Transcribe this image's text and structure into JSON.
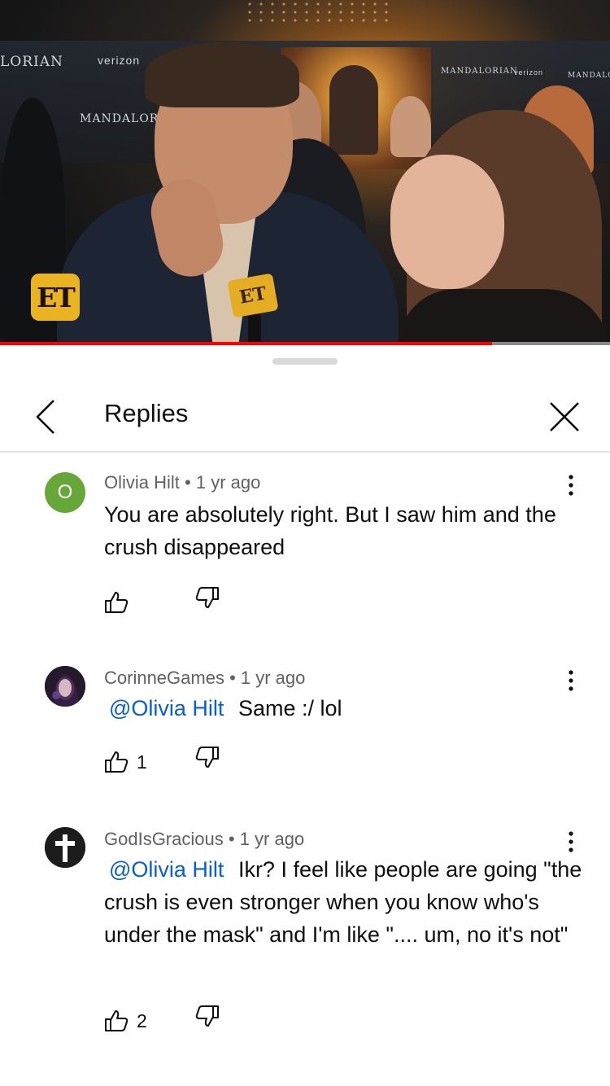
{
  "video": {
    "channel_logo": "ET",
    "mic_label": "ET",
    "banner_texts": [
      "LORIAN",
      "verizon",
      "MANDALORI",
      "MANDALORIAN",
      "verizon",
      "MANDALORIAN"
    ],
    "progress": 0.806,
    "progress_color": "#ff0000"
  },
  "panel": {
    "title": "Replies",
    "back_icon": "chevron-left-icon",
    "close_icon": "close-icon"
  },
  "comments": [
    {
      "author": "Olivia Hilt",
      "time": "1 yr ago",
      "avatar_letter": "O",
      "avatar_color": "#67a73a",
      "mention": "",
      "text": "You are absolutely right. But I saw him and the crush disappeared",
      "likes": ""
    },
    {
      "author": "CorinneGames",
      "time": "1 yr ago",
      "avatar_letter": "",
      "mention": "@Olivia Hilt",
      "text": "Same :/ lol",
      "likes": "1"
    },
    {
      "author": "GodIsGracious",
      "time": "1 yr ago",
      "avatar_letter": "",
      "mention": "@Olivia Hilt",
      "text": "Ikr? I feel like people are going \"the crush is even stronger when you know who's under the mask\" and I'm like \".... um, no it's not\"",
      "likes": "2"
    }
  ],
  "colors": {
    "link": "#065fd4",
    "meta": "#606060",
    "text": "#0f0f0f",
    "divider": "#e5e5e5"
  }
}
